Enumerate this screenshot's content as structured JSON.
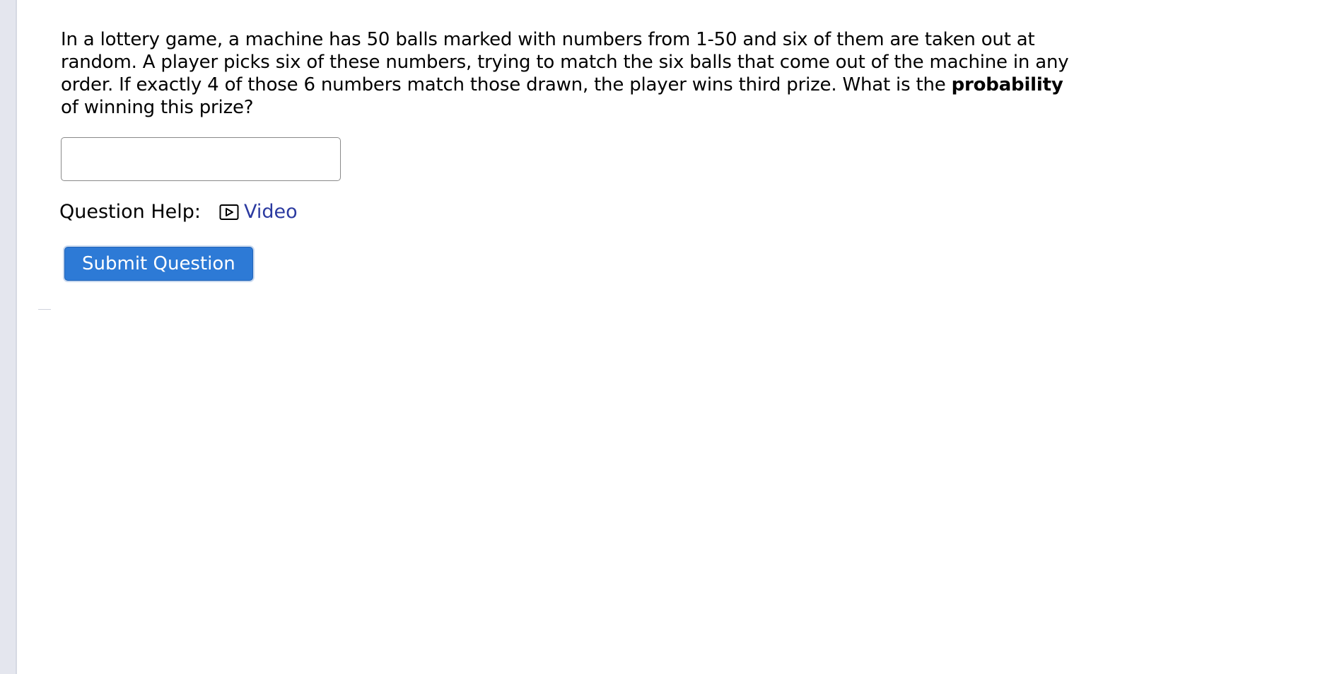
{
  "question": {
    "text_before_bold": "In a lottery game, a machine has 50 balls marked with numbers from 1-50 and six of them are taken out at random. A player picks six of these numbers, trying to match the six balls that come out of the machine in any order. If exactly 4 of those 6 numbers match those drawn, the player wins third prize. What is the ",
    "bold_text": "probability",
    "text_after_bold": " of winning this prize?"
  },
  "answer": {
    "value": "",
    "placeholder": ""
  },
  "help": {
    "label": "Question Help:",
    "video_label": "Video",
    "video_icon": "play-video-icon",
    "link_color": "#2b3aa0"
  },
  "submit": {
    "label": "Submit Question",
    "color": "#2d7ad6"
  }
}
